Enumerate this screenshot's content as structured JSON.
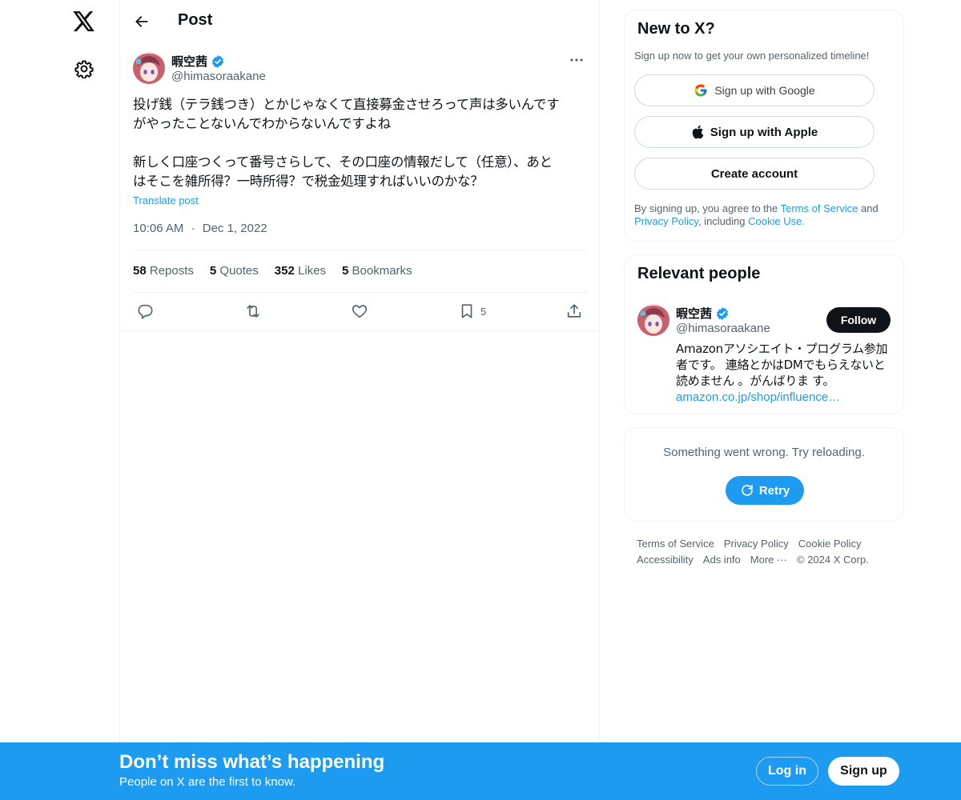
{
  "nav": {
    "logo_icon": "x-logo-icon",
    "settings_icon": "gear-icon"
  },
  "header": {
    "title": "Post",
    "back_icon": "arrow-left-icon"
  },
  "post": {
    "author_name": "暇空茜",
    "author_handle": "@himasoraakane",
    "verified": true,
    "text": "投げ銭（テラ銭つき）とかじゃなくて直接募金させろって声は多いんです\nがやったことないんでわからないんですよね\n\n新しく口座つくって番号さらして、その口座の情報だして（任意）、あと\nはそこを雑所得？一時所得？で税金処理すればいいのかな？",
    "translate_label": "Translate post",
    "time": "10:06 AM",
    "date": "Dec 1, 2022",
    "separator": "·",
    "stats": [
      {
        "value": "58",
        "label": "Reposts"
      },
      {
        "value": "5",
        "label": "Quotes"
      },
      {
        "value": "352",
        "label": "Likes"
      },
      {
        "value": "5",
        "label": "Bookmarks"
      }
    ],
    "bookmark_count": "5"
  },
  "signup_card": {
    "title": "New to X?",
    "subtitle": "Sign up now to get your own personalized timeline!",
    "google_label": "Sign up with Google",
    "apple_label": "Sign up with Apple",
    "create_label": "Create account",
    "legal_prefix": "By signing up, you agree to the ",
    "terms_link": "Terms of Service",
    "legal_and": " and",
    "privacy_link": "Privacy Policy",
    "legal_including": ", including ",
    "cookie_link": "Cookie Use."
  },
  "relevant_people": {
    "title": "Relevant people",
    "name": "暇空茜",
    "handle": "@himasoraakane",
    "follow_label": "Follow",
    "bio": "Amazonアソシエイト・プログラム参加者です。 連絡とかはDMでもらえないと読めません 。がんばりま す。",
    "bio_link": "amazon.co.jp/shop/influence…"
  },
  "error_card": {
    "message": "Something went wrong. Try reloading.",
    "retry_label": "Retry"
  },
  "footer": {
    "links": [
      "Terms of Service",
      "Privacy Policy",
      "Cookie Policy",
      "Accessibility",
      "Ads info",
      "More ···"
    ],
    "copyright": "© 2024 X Corp."
  },
  "banner": {
    "title": "Don’t miss what’s happening",
    "subtitle": "People on X are the first to know.",
    "login_label": "Log in",
    "signup_label": "Sign up"
  },
  "colors": {
    "accent": "#1d9bf0",
    "text": "#0f1419",
    "muted": "#536471",
    "border": "#eff3f4"
  }
}
